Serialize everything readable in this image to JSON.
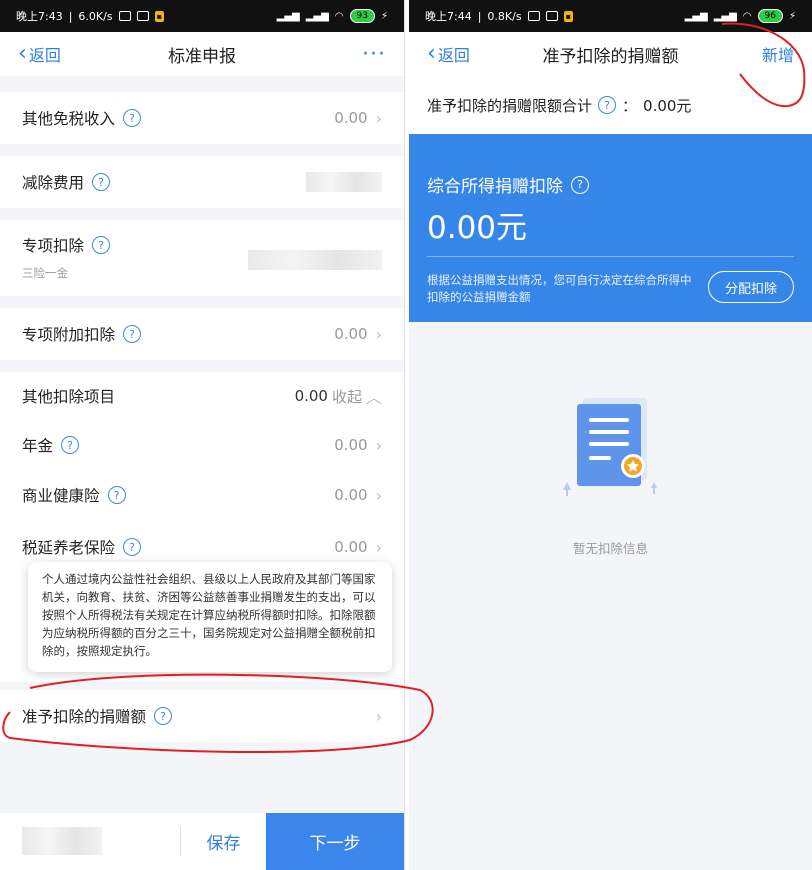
{
  "left": {
    "status": {
      "time": "晚上7:43",
      "speed": "6.0K/s",
      "battery": "93"
    },
    "nav": {
      "back": "返回",
      "title": "标准申报"
    },
    "rows": {
      "other_exempt": {
        "label": "其他免税收入",
        "value": "0.00"
      },
      "deduction_fee": {
        "label": "减除费用"
      },
      "special": {
        "label": "专项扣除",
        "note": "三险一金"
      },
      "special_additional": {
        "label": "专项附加扣除",
        "value": "0.00"
      },
      "other_items": {
        "label": "其他扣除项目",
        "value": "0.00",
        "toggle": "收起"
      },
      "annuity": {
        "label": "年金",
        "value": "0.00"
      },
      "health": {
        "label": "商业健康险",
        "value": "0.00"
      },
      "pension": {
        "label": "税延养老保险",
        "value": "0.00"
      },
      "donation": {
        "label": "准予扣除的捐赠额"
      }
    },
    "tooltip": "个人通过境内公益性社会组织、县级以上人民政府及其部门等国家机关，向教育、扶贫、济困等公益慈善事业捐赠发生的支出，可以按照个人所得税法有关规定在计算应纳税所得额时扣除。扣除限额为应纳税所得额的百分之三十，国务院规定对公益捐赠全额税前扣除的，按照规定执行。",
    "bottom": {
      "save": "保存",
      "next": "下一步"
    }
  },
  "right": {
    "status": {
      "time": "晚上7:44",
      "speed": "0.8K/s",
      "battery": "96"
    },
    "nav": {
      "back": "返回",
      "title": "准予扣除的捐赠额",
      "add": "新增"
    },
    "limit": {
      "label": "准予扣除的捐赠限额合计",
      "colon": "：",
      "value": "0.00元"
    },
    "card": {
      "title": "综合所得捐赠扣除",
      "amount": "0.00元",
      "desc": "根据公益捐赠支出情况，您可自行决定在综合所得中扣除的公益捐赠金额",
      "button": "分配扣除"
    },
    "empty": "暂无扣除信息"
  },
  "icons": {
    "help": "?",
    "chevron_left": "‹",
    "chevron_right": "›",
    "chevron_up": "︿",
    "more": "···"
  },
  "colors": {
    "primary_blue": "#3686ea",
    "link_blue": "#2f7ee6",
    "annotation_red": "#e02020"
  }
}
